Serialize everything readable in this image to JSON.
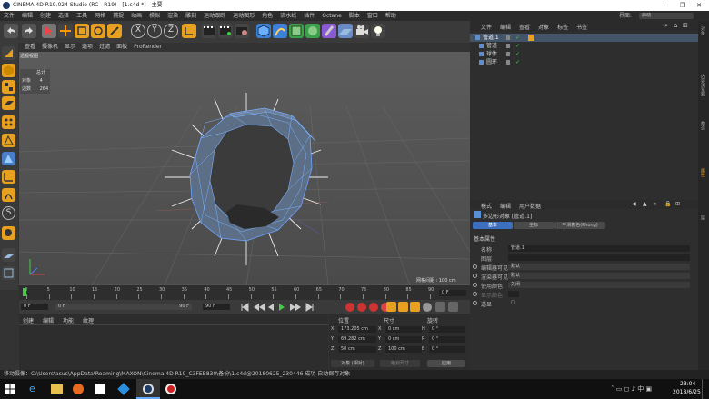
{
  "title_bar": {
    "text": "CINEMA 4D R19.024 Studio (RC - R19) - [1.c4d *] - 主要",
    "controls": [
      "─",
      "❐",
      "✕"
    ]
  },
  "menu": {
    "items": [
      "文件",
      "编辑",
      "创建",
      "选择",
      "工具",
      "网格",
      "捕捉",
      "动画",
      "模拟",
      "渲染",
      "雕刻",
      "运动跟踪",
      "运动图形",
      "角色",
      "流水线",
      "插件",
      "Octane",
      "脚本",
      "窗口",
      "帮助"
    ],
    "layout_label": "界面:",
    "layout_value": "启动"
  },
  "viewport": {
    "tabs": [
      "查看",
      "摄像机",
      "显示",
      "选项",
      "过滤",
      "面板",
      "ProRender"
    ],
    "view_name": "透视视图",
    "stats": {
      "header": "总计",
      "objects_label": "对象",
      "objects": "4",
      "faces_label": "边数",
      "faces": "264"
    },
    "grid_spacing": "网格间距 : 100 cm"
  },
  "timeline": {
    "ticks": [
      "0",
      "5",
      "10",
      "15",
      "20",
      "25",
      "30",
      "35",
      "40",
      "45",
      "50",
      "55",
      "60",
      "65",
      "70",
      "75",
      "80",
      "85",
      "90"
    ],
    "end_field": "0 F"
  },
  "transport": {
    "start": "0 F",
    "cur": "0 F",
    "end": "90 F",
    "end2": "90 F"
  },
  "material": {
    "tabs": [
      "创建",
      "编辑",
      "功能",
      "纹理"
    ]
  },
  "coords": {
    "headers": [
      "位置",
      "尺寸",
      "旋转"
    ],
    "rows": [
      {
        "a": "X",
        "v": "173.205 cm",
        "b": "X",
        "s": "0 cm",
        "c": "H",
        "r": "0 °"
      },
      {
        "a": "Y",
        "v": "69.282 cm",
        "b": "Y",
        "s": "0 cm",
        "c": "P",
        "r": "0 °"
      },
      {
        "a": "Z",
        "v": "50 cm",
        "b": "Z",
        "s": "100 cm",
        "c": "B",
        "r": "0 °"
      }
    ],
    "mode": "对象 (相对)",
    "size_mode": "绝对尺寸",
    "apply": "应用"
  },
  "objects": {
    "tabs": [
      "文件",
      "编辑",
      "查看",
      "对象",
      "标签",
      "书签"
    ],
    "items": [
      "管道.1",
      "管道",
      "球体",
      "圆环"
    ]
  },
  "attributes": {
    "tabs": [
      "模式",
      "编辑",
      "用户数据"
    ],
    "object_name": "多边形对象 [管道.1]",
    "subtabs": [
      "基本",
      "坐标",
      "平滑着色(Phong)"
    ],
    "section": "基本属性",
    "fields": [
      {
        "label": "名称",
        "value": "管道.1"
      },
      {
        "label": "图层",
        "value": ""
      },
      {
        "label": "编辑器可见",
        "value": "默认"
      },
      {
        "label": "渲染器可见",
        "value": "默认"
      },
      {
        "label": "使用颜色",
        "value": "关闭"
      },
      {
        "label": "显示颜色",
        "value": ""
      },
      {
        "label": "透显",
        "value": "□"
      }
    ]
  },
  "right_tabs": [
    "对象",
    "内容浏览器",
    "构造",
    "属性",
    "层"
  ],
  "status": "移动摄像：C:\\Users\\asus\\AppData\\Roaming\\MAXON\\Cinema 4D R19_C3FEB830\\备份\\1.c4d@20180625_230446 成功    自动保存对象",
  "taskbar": {
    "time": "23:04",
    "date": "2018/6/25"
  },
  "colors": {
    "accent": "#3d6fbf",
    "background": "#333333"
  }
}
